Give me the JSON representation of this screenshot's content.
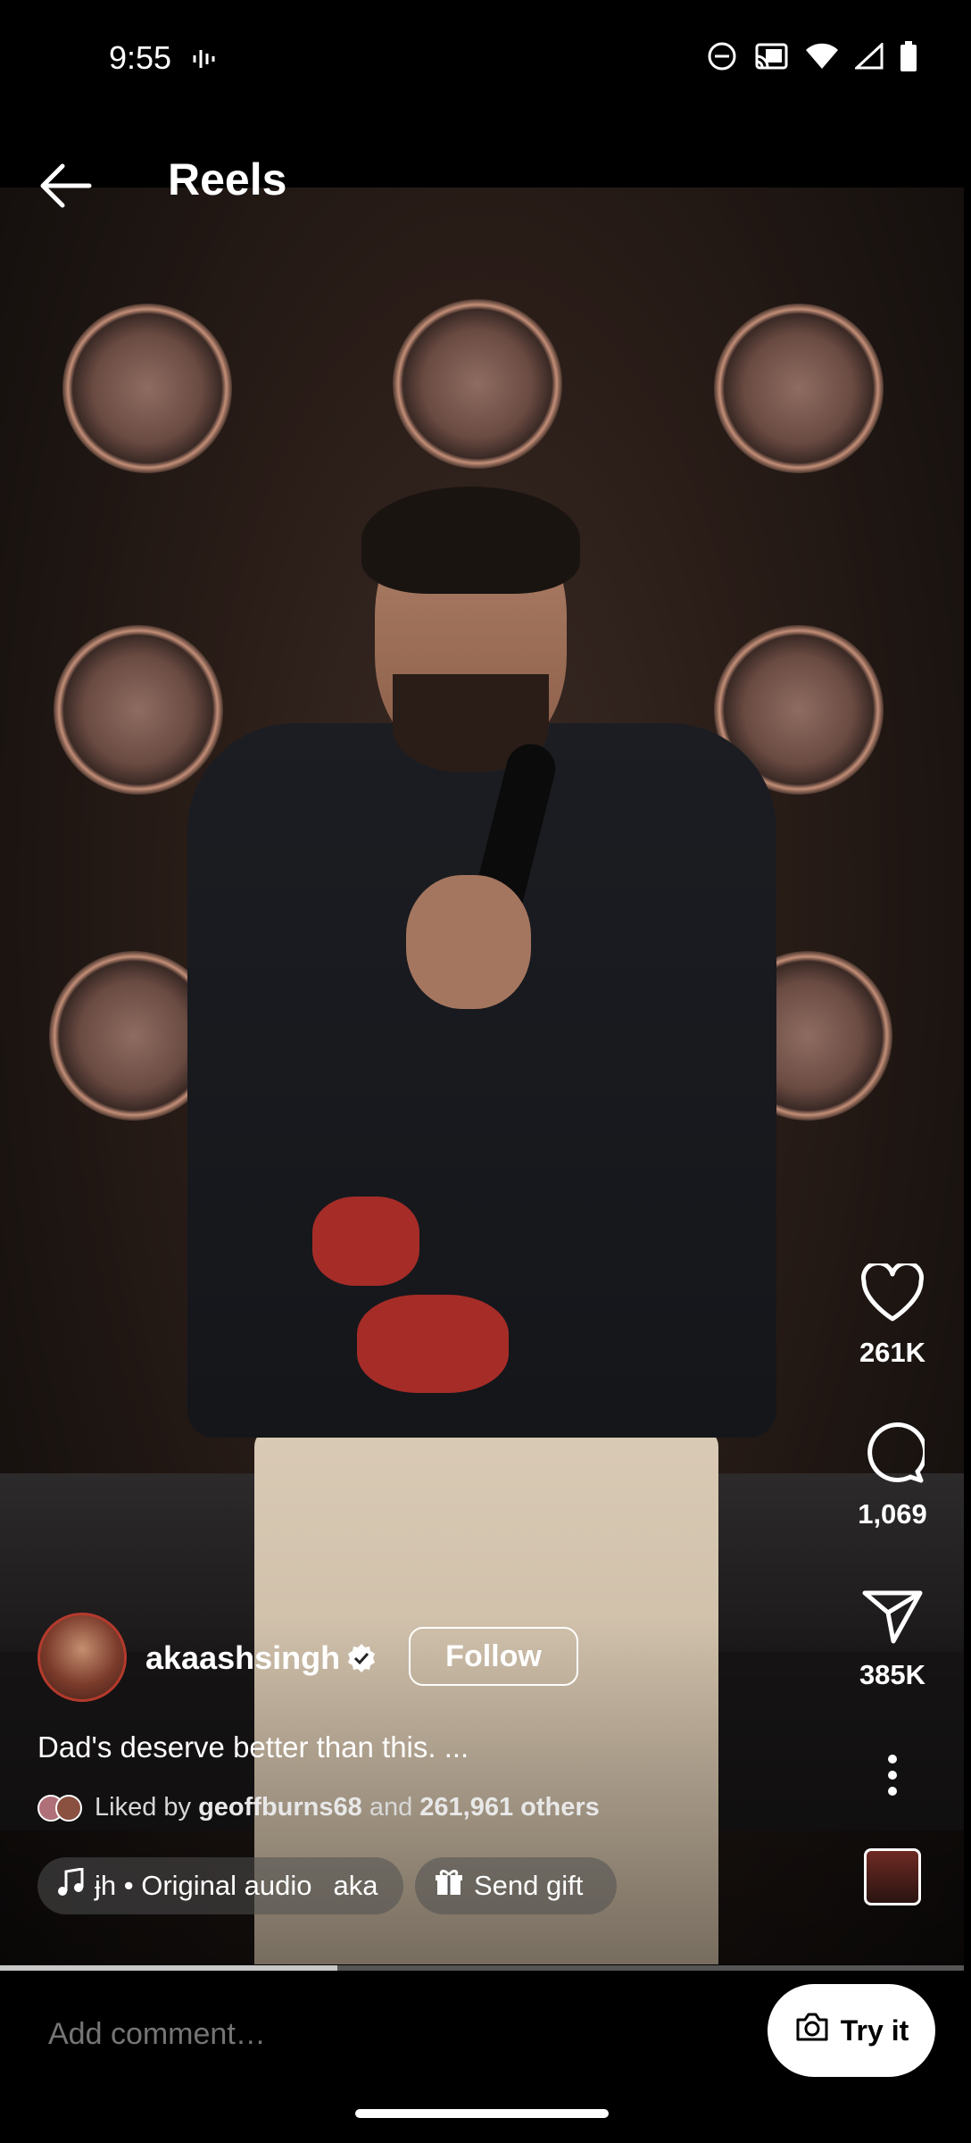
{
  "status_bar": {
    "time": "9:55"
  },
  "header": {
    "title": "Reels"
  },
  "actions": {
    "likes": "261K",
    "comments": "1,069",
    "shares": "385K"
  },
  "author": {
    "username": "akaashsingh",
    "follow_label": "Follow"
  },
  "post": {
    "caption": "Dad's deserve better than this. ...",
    "liked_by_prefix": "Liked by",
    "liked_by_user": "geoffburns68",
    "liked_by_and": "and",
    "liked_by_others": "261,961 others"
  },
  "audio": {
    "label": "ɉh • Original audio",
    "suffix": "aka"
  },
  "gift": {
    "label": "Send gift"
  },
  "playback": {
    "progress_fraction": 0.35
  },
  "comment": {
    "placeholder": "Add comment…"
  },
  "try_it": {
    "label": "Try it"
  },
  "icons": [
    "back-arrow-icon",
    "heart-icon",
    "comment-icon",
    "share-icon",
    "more-options-icon",
    "music-note-icon",
    "gift-icon",
    "camera-icon",
    "verified-badge-icon"
  ]
}
